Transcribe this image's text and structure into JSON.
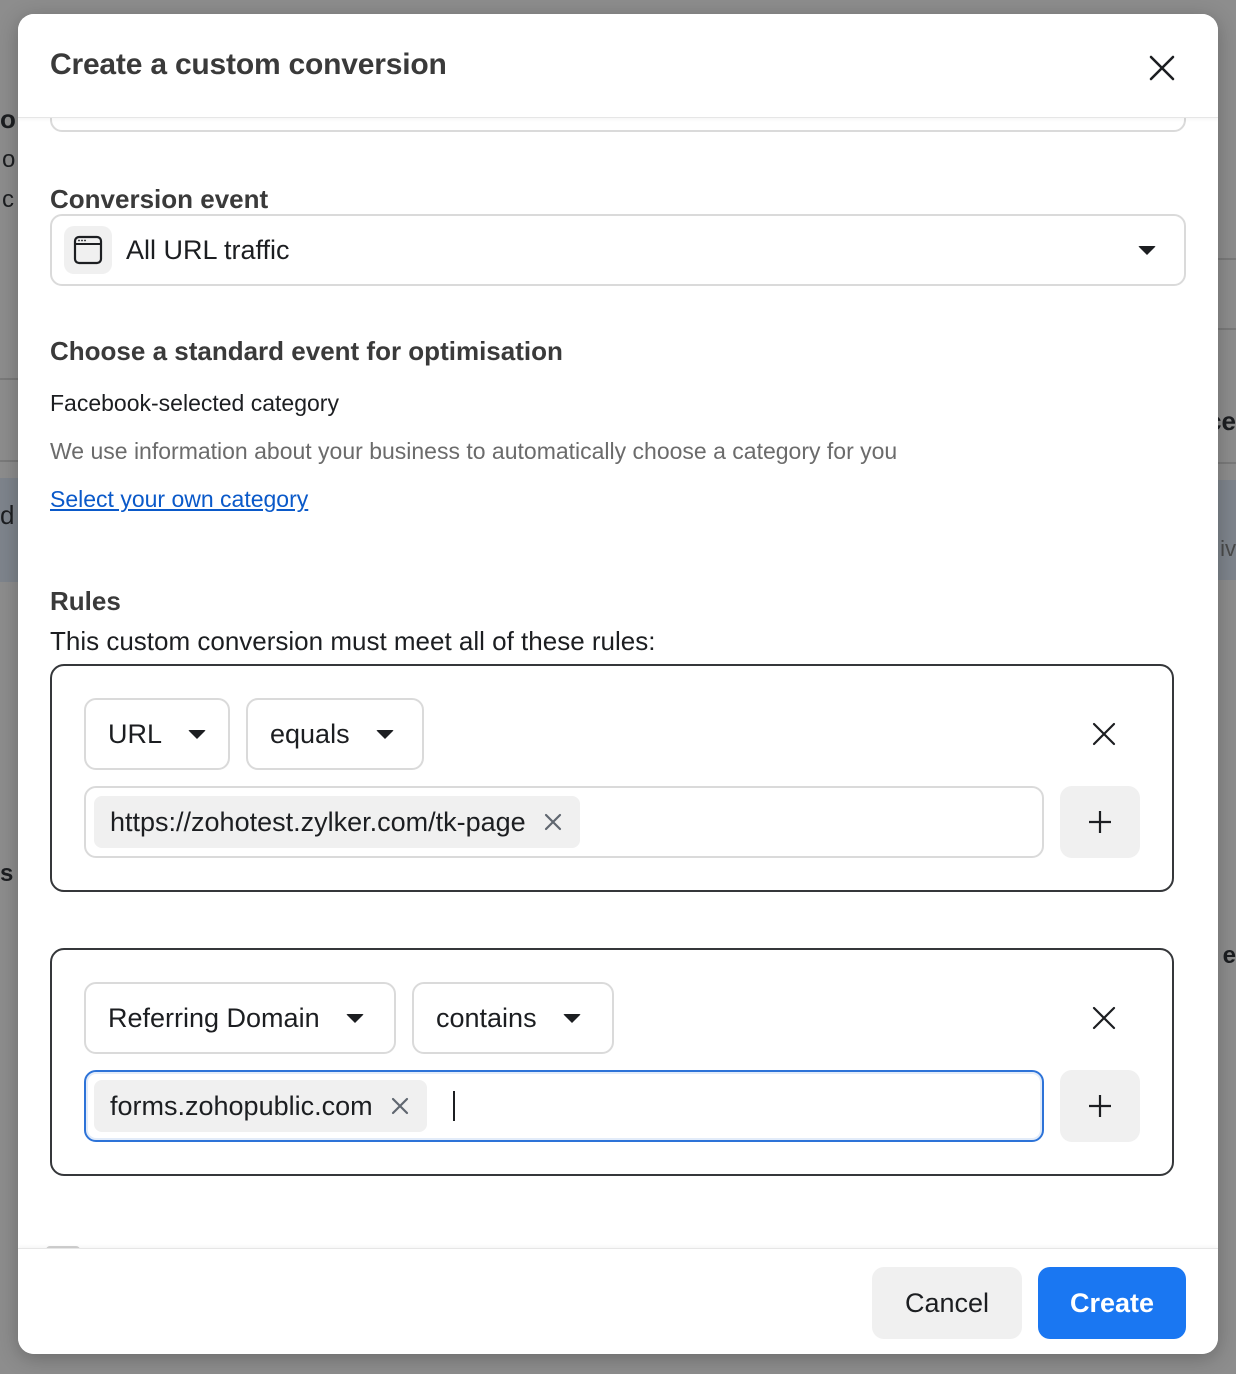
{
  "background": {
    "left_fragments": [
      "o",
      "o",
      "c",
      "d",
      "s"
    ],
    "right_fragments": [
      "ce",
      "iv",
      "e"
    ]
  },
  "modal": {
    "title": "Create a custom conversion",
    "close_icon": "close-icon"
  },
  "conversion_event": {
    "label": "Conversion event",
    "selected": "All URL traffic",
    "icon": "browser-window-icon"
  },
  "optimisation": {
    "heading": "Choose a standard event for optimisation",
    "category_label": "Facebook-selected category",
    "description": "We use information about your business to automatically choose a category for you",
    "link": "Select your own category"
  },
  "rules": {
    "heading": "Rules",
    "description": "This custom conversion must meet all of these rules:",
    "items": [
      {
        "field": "URL",
        "operator": "equals",
        "values": [
          "https://zohotest.zylker.com/tk-page"
        ],
        "focused": false
      },
      {
        "field": "Referring Domain",
        "operator": "contains",
        "values": [
          "forms.zohopublic.com"
        ],
        "focused": true
      }
    ]
  },
  "footer": {
    "cancel_label": "Cancel",
    "create_label": "Create",
    "accent_color": "#1a77f2"
  }
}
